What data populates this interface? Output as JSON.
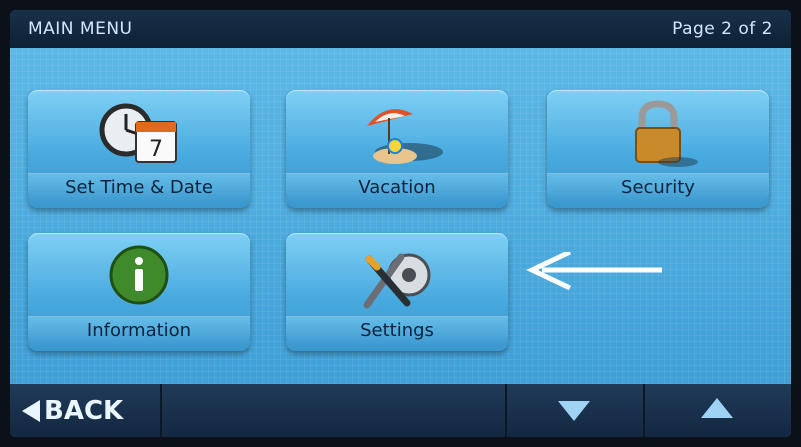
{
  "header": {
    "title": "MAIN MENU",
    "page_indicator": "Page 2 of 2"
  },
  "tiles": [
    {
      "label": "Set Time & Date",
      "icon": "clock-calendar-icon",
      "calendar_day": "7"
    },
    {
      "label": "Vacation",
      "icon": "beach-umbrella-icon"
    },
    {
      "label": "Security",
      "icon": "padlock-icon"
    },
    {
      "label": "Information",
      "icon": "info-icon"
    },
    {
      "label": "Settings",
      "icon": "wrench-gear-icon"
    }
  ],
  "footer": {
    "back_label": "BACK"
  },
  "colors": {
    "screen_blue": "#3a9ed4",
    "bar_navy": "#132841",
    "label_text": "#10233a"
  }
}
